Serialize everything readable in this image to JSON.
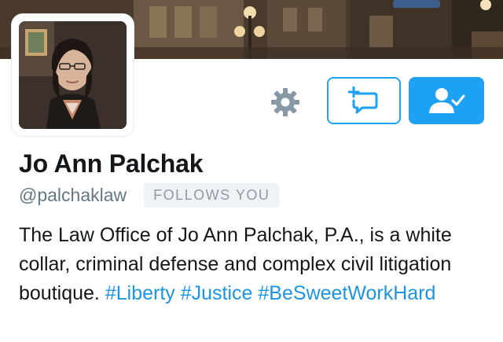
{
  "profile": {
    "display_name": "Jo Ann Palchak",
    "handle": "@palchaklaw",
    "follows_badge": "FOLLOWS YOU",
    "bio": {
      "text": "The Law Office of Jo Ann Palchak, P.A., is a white collar, criminal defense and complex civil litigation boutique.",
      "hashtags": [
        "#Liberty",
        "#Justice",
        "#BeSweetWorkHard"
      ]
    }
  },
  "actions": {
    "settings_icon": "gear-icon",
    "message_icon": "new-message-icon",
    "following_icon": "person-check-icon"
  },
  "colors": {
    "accent": "#1da1f2",
    "hashtag": "#1b95e0",
    "name": "#14171a",
    "handle": "#657786",
    "badge_bg": "#f0f3f6",
    "badge_text": "#8e9ba5",
    "gear": "#8899a6"
  }
}
